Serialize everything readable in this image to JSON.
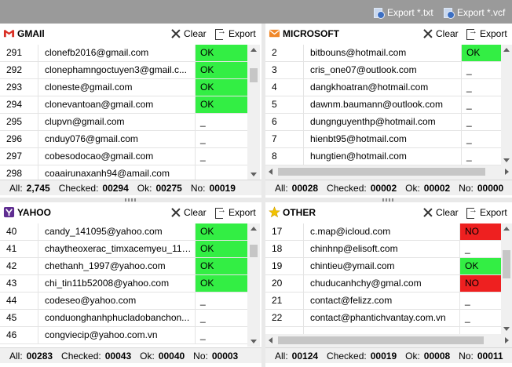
{
  "toolbar": {
    "export_txt_label": "Export *.txt",
    "export_vcf_label": "Export *.vcf"
  },
  "panels": {
    "gmail": {
      "title": "GMAIl",
      "clear_label": "Clear",
      "export_label": "Export",
      "rows": [
        {
          "idx": "291",
          "email": "clonefb2016@gmail.com",
          "status": "OK"
        },
        {
          "idx": "292",
          "email": "clonephamngoctuyen3@gmail.c...",
          "status": "OK"
        },
        {
          "idx": "293",
          "email": "cloneste@gmail.com",
          "status": "OK"
        },
        {
          "idx": "294",
          "email": "clonevantoan@gmail.com",
          "status": "OK"
        },
        {
          "idx": "295",
          "email": "clupvn@gmail.com",
          "status": "_"
        },
        {
          "idx": "296",
          "email": "cnduy076@gmail.com",
          "status": "_"
        },
        {
          "idx": "297",
          "email": "cobesodocao@gmail.com",
          "status": "_"
        },
        {
          "idx": "298",
          "email": "coaairunaxanh94@amail.com",
          "status": ""
        }
      ],
      "footer": {
        "all_label": "All:",
        "all": "2,745",
        "checked_label": "Checked:",
        "checked": "00294",
        "ok_label": "Ok:",
        "ok": "00275",
        "no_label": "No:",
        "no": "00019"
      }
    },
    "microsoft": {
      "title": "MICROSOFT",
      "clear_label": "Clear",
      "export_label": "Export",
      "rows": [
        {
          "idx": "2",
          "email": "bitbouns@hotmail.com",
          "status": "OK"
        },
        {
          "idx": "3",
          "email": "cris_one07@outlook.com",
          "status": "_"
        },
        {
          "idx": "4",
          "email": "dangkhoatran@hotmail.com",
          "status": "_"
        },
        {
          "idx": "5",
          "email": "dawnm.baumann@outlook.com",
          "status": "_"
        },
        {
          "idx": "6",
          "email": "dungnguyenthp@hotmail.com",
          "status": "_"
        },
        {
          "idx": "7",
          "email": "hienbt95@hotmail.com",
          "status": "_"
        },
        {
          "idx": "8",
          "email": "hungtien@hotmail.com",
          "status": "_"
        }
      ],
      "footer": {
        "all_label": "All:",
        "all": "00028",
        "checked_label": "Checked:",
        "checked": "00002",
        "ok_label": "Ok:",
        "ok": "00002",
        "no_label": "No:",
        "no": "00000"
      }
    },
    "yahoo": {
      "title": "YAHOO",
      "clear_label": "Clear",
      "export_label": "Export",
      "rows": [
        {
          "idx": "40",
          "email": "candy_141095@yahoo.com",
          "status": "OK"
        },
        {
          "idx": "41",
          "email": "chaytheoxerac_timxacemyeu_117...",
          "status": "OK"
        },
        {
          "idx": "42",
          "email": "chethanh_1997@yahoo.com",
          "status": "OK"
        },
        {
          "idx": "43",
          "email": "chi_tin11b52008@yahoo.com",
          "status": "OK"
        },
        {
          "idx": "44",
          "email": "codeseo@yahoo.com",
          "status": "_"
        },
        {
          "idx": "45",
          "email": "conduonghanhphucladobanchon...",
          "status": "_"
        },
        {
          "idx": "46",
          "email": "congviecip@yahoo.com.vn",
          "status": "_"
        }
      ],
      "footer": {
        "all_label": "All:",
        "all": "00283",
        "checked_label": "Checked:",
        "checked": "00043",
        "ok_label": "Ok:",
        "ok": "00040",
        "no_label": "No:",
        "no": "00003"
      }
    },
    "other": {
      "title": "OTHER",
      "clear_label": "Clear",
      "export_label": "Export",
      "rows": [
        {
          "idx": "17",
          "email": "c.map@icloud.com",
          "status": "NO"
        },
        {
          "idx": "18",
          "email": "chinhnp@elisoft.com",
          "status": "_"
        },
        {
          "idx": "19",
          "email": "chintieu@ymail.com",
          "status": "OK"
        },
        {
          "idx": "20",
          "email": "chuducanhchy@gmal.com",
          "status": "NO"
        },
        {
          "idx": "21",
          "email": "contact@felizz.com",
          "status": "_"
        },
        {
          "idx": "22",
          "email": "contact@phantichvantay.com.vn",
          "status": "_"
        }
      ],
      "footer": {
        "all_label": "All:",
        "all": "00124",
        "checked_label": "Checked:",
        "checked": "00019",
        "ok_label": "Ok:",
        "ok": "00008",
        "no_label": "No:",
        "no": "00011"
      }
    }
  },
  "colors": {
    "ok": "#33ee44",
    "no": "#ee2020",
    "gmail_icon": "#d93025",
    "microsoft_icon": "#f0882a",
    "yahoo_icon": "#5f2d91",
    "other_icon": "#f2c200"
  },
  "icons": {
    "gmail": "gmail-icon",
    "microsoft": "mail-envelope-icon",
    "yahoo": "yahoo-icon",
    "other": "star-icon",
    "clear": "close-icon",
    "export": "export-icon"
  }
}
